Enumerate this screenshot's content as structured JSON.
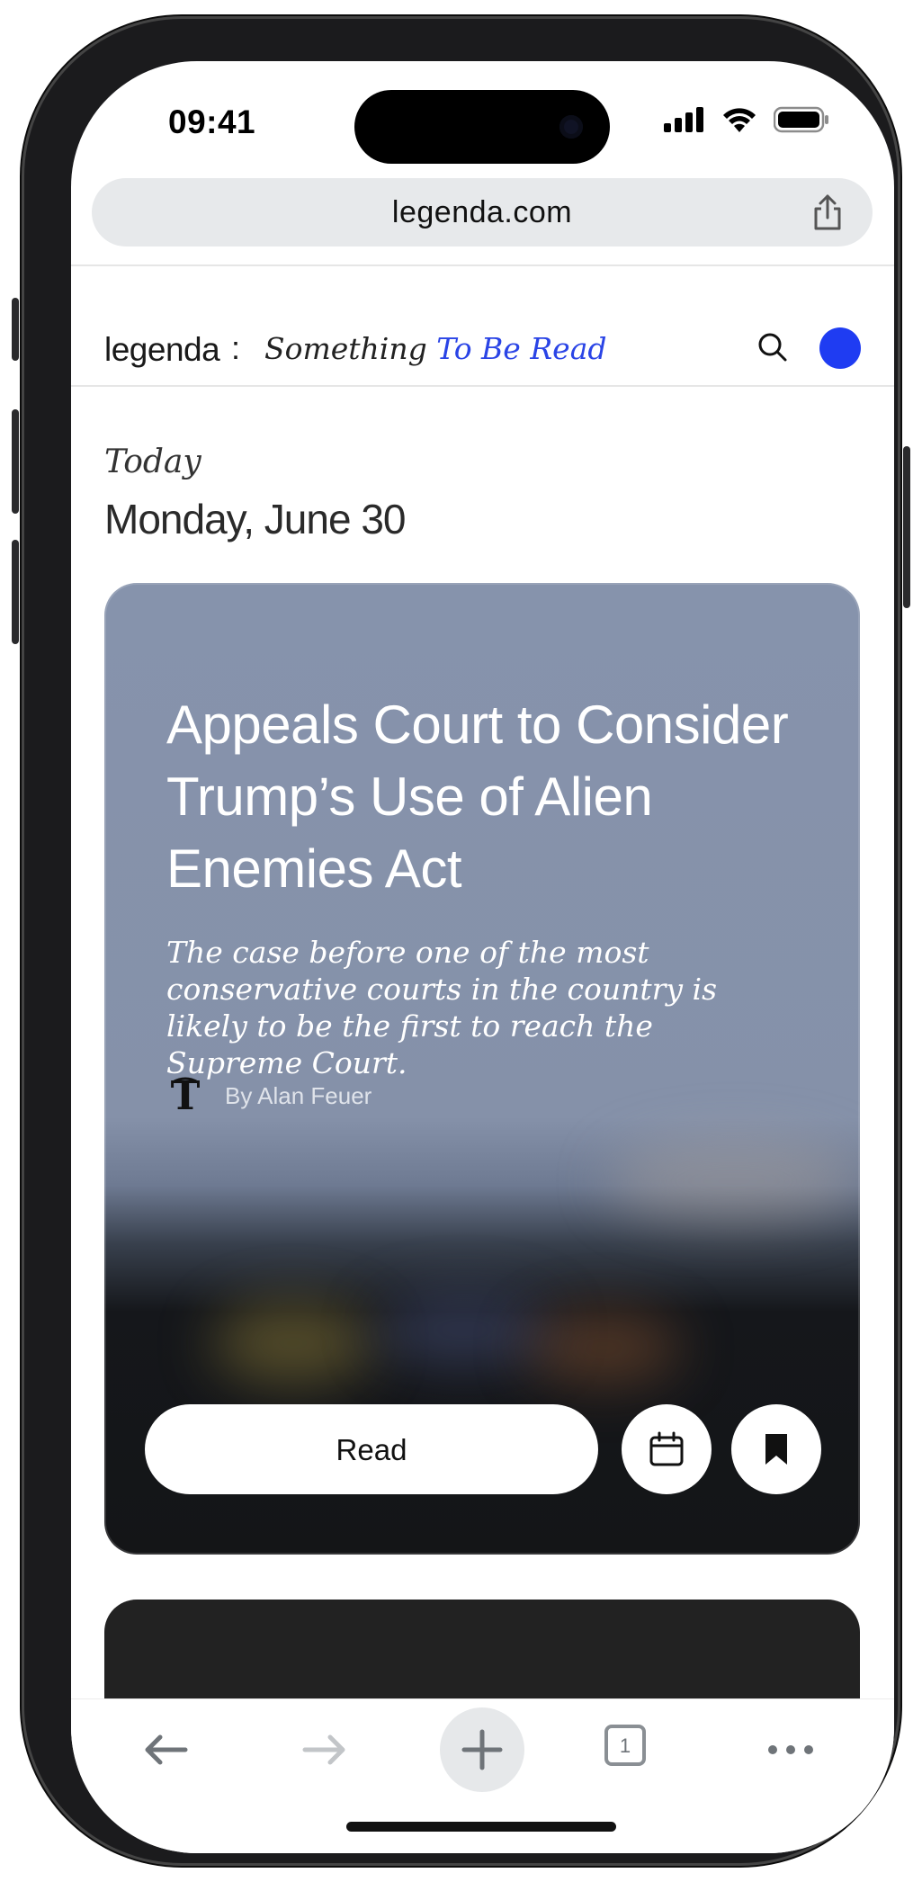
{
  "status_bar": {
    "time": "09:41"
  },
  "browser": {
    "url": "legenda.com",
    "tab_count": "1"
  },
  "site": {
    "logo": "legenda",
    "separator": ":",
    "tagline_part1": "Something",
    "tagline_part2": "To Be Read",
    "accent_color": "#1f3cf2"
  },
  "feed": {
    "today_label": "Today",
    "date": "Monday, June 30",
    "card": {
      "headline": "Appeals Court to Consider Trump’s Use of Alien Enemies Act",
      "dek": "The case before one of the most conservative courts in the country is likely to be the first to reach the Supreme Court.",
      "byline": "By Alan Feuer",
      "read_label": "Read",
      "publisher_icon": "nyt-logo-icon",
      "schedule_icon": "calendar-icon",
      "save_icon": "bookmark-icon"
    }
  },
  "toolbar": {
    "icons": [
      "back-arrow-icon",
      "forward-arrow-icon",
      "plus-icon",
      "tabs-icon",
      "more-icon"
    ]
  }
}
